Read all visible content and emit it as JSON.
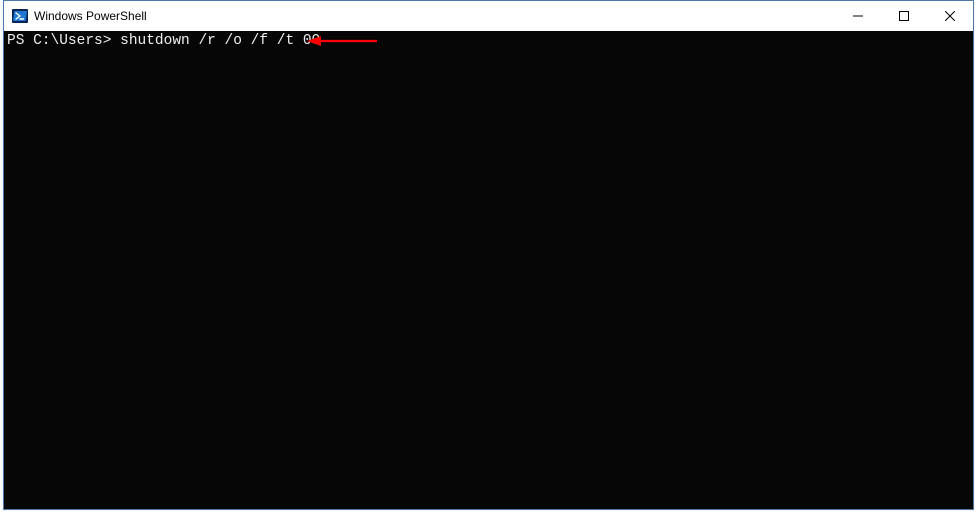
{
  "window": {
    "title": "Windows PowerShell"
  },
  "terminal": {
    "prompt": "PS C:\\Users> ",
    "command": "shutdown /r /o /f /t 00"
  },
  "annotation": {
    "type": "arrow",
    "color": "#ff0000"
  }
}
